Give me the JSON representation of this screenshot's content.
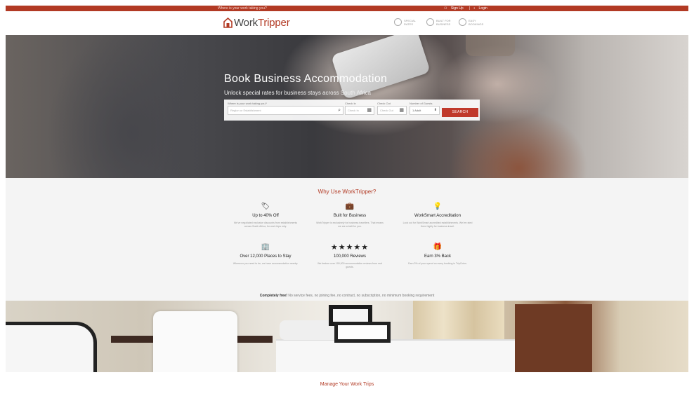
{
  "topbar": {
    "tagline": "Where is your work taking you?",
    "sign_up": "Sign Up",
    "login": "Login"
  },
  "header": {
    "logo_work": "Work",
    "logo_tripper": "Tripper",
    "nav": [
      {
        "label": "SPECIAL RATES",
        "icon": "percent-icon"
      },
      {
        "label": "BUILT FOR BUSINESS",
        "icon": "briefcase-icon"
      },
      {
        "label": "EASY BOOKINGS",
        "icon": "check-icon"
      }
    ]
  },
  "hero": {
    "title": "Book Business Accommodation",
    "subtitle": "Unlock special rates for business stays across South Africa",
    "search": {
      "where_label": "Where is your work taking you?",
      "where_placeholder": "Region or Establishment",
      "checkin_label": "Check In",
      "checkin_placeholder": "Check In",
      "checkout_label": "Check Out",
      "checkout_placeholder": "Check Out",
      "guests_label": "Number of Guests",
      "guests_value": "1 Adult",
      "button": "SEARCH"
    }
  },
  "why": {
    "title": "Why Use WorkTripper?",
    "features": [
      {
        "icon": "tag-icon",
        "glyph": "🏷",
        "heading": "Up to 40% Off",
        "desc": "We've negotiated exclusive discounts from establishments across South Africa, for work trips only."
      },
      {
        "icon": "briefcase-icon",
        "glyph": "💼",
        "heading": "Built for Business",
        "desc": "WorkTripper is exclusively for business travellers. That means we are a built for you."
      },
      {
        "icon": "lightbulb-icon",
        "glyph": "💡",
        "heading": "WorkSmart Accreditation",
        "desc": "Look out for WorkSmart accredited establishments. We've rated them highly for business travel."
      },
      {
        "icon": "building-icon",
        "glyph": "🏢",
        "heading": "Over 12,000 Places to Stay",
        "desc": "Wherever you need to be, we have accommodation nearby."
      },
      {
        "icon": "star-icon",
        "glyph": "★★★★★",
        "heading": "100,000 Reviews",
        "desc": "We feature over 100,000 accommodation reviews from real guests."
      },
      {
        "icon": "gift-icon",
        "glyph": "🎁",
        "heading": "Earn 3% Back",
        "desc": "Earn 3% of your spend on every booking in TripCoins."
      }
    ],
    "free_bold": "Completely free!",
    "free_text": " No service fees, no joining fee, no contract, no subscription, no minimum booking requirement"
  },
  "manage": {
    "title": "Manage Your Work Trips"
  }
}
